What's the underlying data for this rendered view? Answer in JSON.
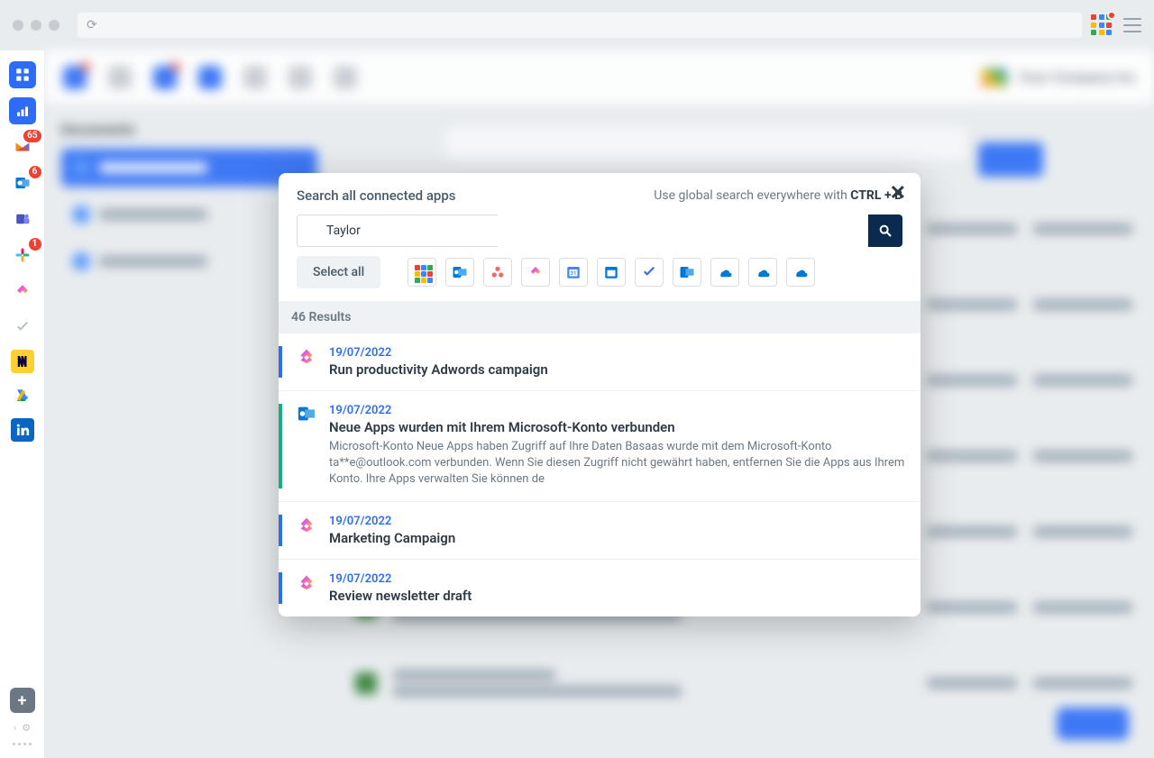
{
  "sidebar": {
    "badges": {
      "gmail": "65",
      "outlook": "6",
      "slack": "1"
    }
  },
  "background": {
    "documents_label": "Documents",
    "company": "Your Company Inc"
  },
  "modal": {
    "title": "Search all connected apps",
    "hint_prefix": "Use global search everywhere with ",
    "hint_shortcut": "CTRL + B",
    "search_value": "Taylor",
    "select_all": "Select all",
    "results_count_label": "46 Results",
    "results": [
      {
        "date": "19/07/2022",
        "title": "Run productivity Adwords campaign",
        "source": "clickup",
        "accent": "blue",
        "snippet": ""
      },
      {
        "date": "19/07/2022",
        "title": "Neue Apps wurden mit Ihrem Microsoft-Konto verbunden",
        "source": "outlook",
        "accent": "green",
        "snippet": "Microsoft-Konto Neue Apps haben Zugriff auf Ihre Daten Basaas wurde mit dem Microsoft-Konto ta**e@outlook.com verbunden. Wenn Sie diesen Zugriff nicht gewährt haben, entfernen Sie die Apps aus Ihrem Konto. Ihre Apps verwalten Sie können de"
      },
      {
        "date": "19/07/2022",
        "title": "Marketing Campaign",
        "source": "clickup",
        "accent": "blue",
        "snippet": ""
      },
      {
        "date": "19/07/2022",
        "title": "Review newsletter draft",
        "source": "clickup",
        "accent": "blue",
        "snippet": ""
      }
    ]
  }
}
